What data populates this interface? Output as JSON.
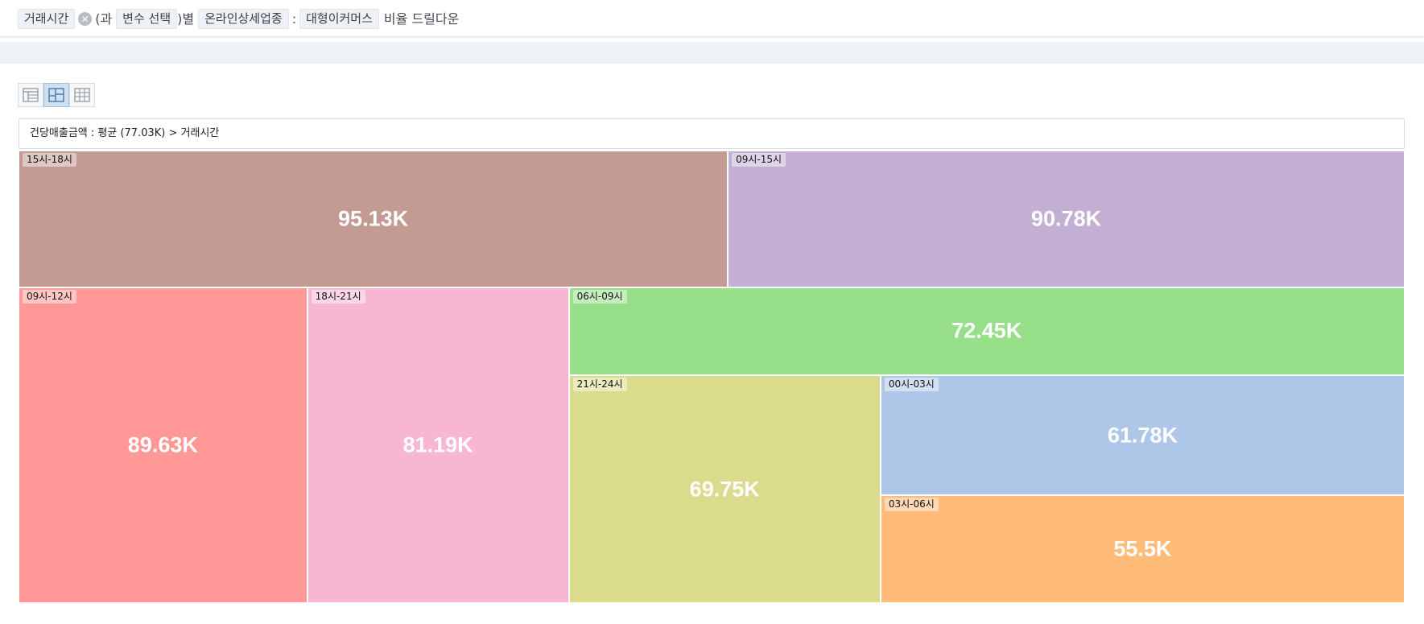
{
  "filter": {
    "tag_time": "거래시간",
    "paren_open": "(과",
    "tag_var": "변수 선택",
    "paren_close": ")별",
    "tag_category": "온라인상세업종",
    "colon": ":",
    "tag_value": "대형이커머스",
    "suffix": "비율 드릴다운"
  },
  "breadcrumb": "건당매출금액 : 평균 (77.03K) > 거래시간",
  "icons": {
    "remove": "close-icon",
    "views": [
      "table-view-icon",
      "treemap-view-icon",
      "grid-view-icon"
    ]
  },
  "chart_data": {
    "type": "treemap",
    "title": "건당매출금액 : 평균 (77.03K) > 거래시간",
    "unit": "K",
    "items": [
      {
        "label": "15시-18시",
        "value": 95.13,
        "display": "95.13K",
        "color": "#c39b93"
      },
      {
        "label": "09시-15시",
        "value": 90.78,
        "display": "90.78K",
        "color": "#c3afd4"
      },
      {
        "label": "09시-12시",
        "value": 89.63,
        "display": "89.63K",
        "color": "#ff9896"
      },
      {
        "label": "18시-21시",
        "value": 81.19,
        "display": "81.19K",
        "color": "#f7b6d2"
      },
      {
        "label": "06시-09시",
        "value": 72.45,
        "display": "72.45K",
        "color": "#98df8a"
      },
      {
        "label": "21시-24시",
        "value": 69.75,
        "display": "69.75K",
        "color": "#dbdb8d"
      },
      {
        "label": "00시-03시",
        "value": 61.78,
        "display": "61.78K",
        "color": "#aec7e8"
      },
      {
        "label": "03시-06시",
        "value": 55.5,
        "display": "55.5K",
        "color": "#ffbb78"
      }
    ]
  }
}
